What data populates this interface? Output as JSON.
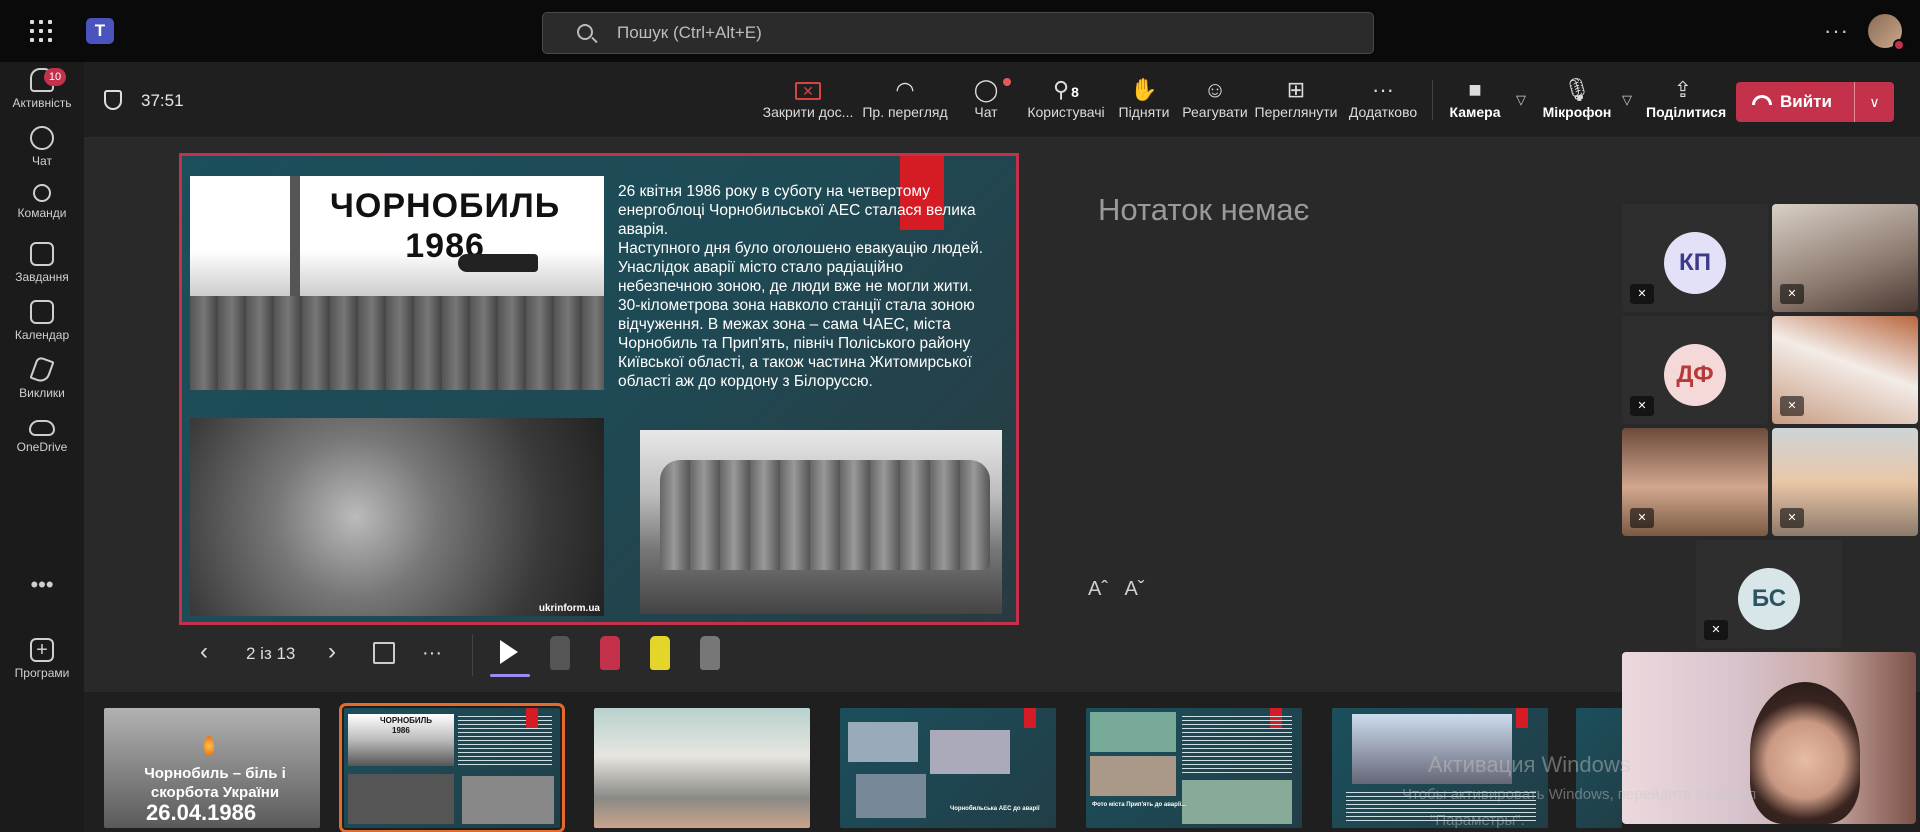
{
  "search": {
    "placeholder": "Пошук (Ctrl+Alt+E)"
  },
  "rail": {
    "items": [
      {
        "label": "Активність",
        "badge": "10"
      },
      {
        "label": "Чат"
      },
      {
        "label": "Команди"
      },
      {
        "label": "Завдання"
      },
      {
        "label": "Календар"
      },
      {
        "label": "Виклики"
      },
      {
        "label": "OneDrive"
      },
      {
        "label": "Програми"
      }
    ],
    "more": "•••"
  },
  "meeting": {
    "timer": "37:51",
    "buttons": {
      "close_share": "Закрити дос...",
      "private_view": "Пр. перегляд",
      "chat": "Чат",
      "people": "Користувачі",
      "people_count": "8",
      "raise": "Підняти",
      "react": "Реагувати",
      "view": "Переглянути",
      "more": "Додатково",
      "camera": "Камера",
      "mic": "Мікрофон",
      "share": "Поділитися",
      "leave": "Вийти"
    }
  },
  "slide": {
    "photo_title_line1": "ЧОРНОБИЛЬ",
    "photo_title_line2": "1986",
    "photo_source": "ukrinform.ua",
    "paragraph1": "26 квітня 1986 року в суботу на четвертому енергоблоці Чорнобильської АЕС сталася велика аварія.",
    "paragraph2": " Наступного дня було оголошено евакуацію людей. Унаслідок аварії місто стало радіаційно небезпечною зоною, де люди вже не могли жити.",
    "paragraph3": "  30-кілометрова зона навколо станції стала зоною відчуження. В межах зона – сама ЧАЕС, міста Чорнобиль та Прип'ять, північ Поліського району Київської області, а також частина Житомирської області аж до кордону з Білоруссю."
  },
  "notes": {
    "empty": "Нотаток немає",
    "font_up": "Aˆ",
    "font_down": "Aˇ"
  },
  "slide_nav": {
    "page": "2 із 13"
  },
  "participants": [
    {
      "initials": "КП",
      "color": "#e3e1f7",
      "text_color": "#3b3a8c"
    },
    {
      "initials": "ДФ",
      "color": "#f5d8d8",
      "text_color": "#b53b3b"
    },
    {
      "initials": "БС",
      "color": "#d8e6ea",
      "text_color": "#2c5360"
    }
  ],
  "thumbnails": {
    "t1_line1": "Чорнобиль – біль і",
    "t1_line2": "скорбота України",
    "t1_date": "26.04.1986",
    "t2_title": "ЧОРНОБИЛЬ",
    "t2_year": "1986",
    "t4_caption": "Чорнобильська АЕС до аварії",
    "t5_caption": "Фото міста Прип'ять до аварії..."
  },
  "watermark": {
    "line1": "Активация Windows",
    "line2": "Чтобы активировать Windows, перейдите в раздел",
    "line3": "\"Параметры\"."
  }
}
